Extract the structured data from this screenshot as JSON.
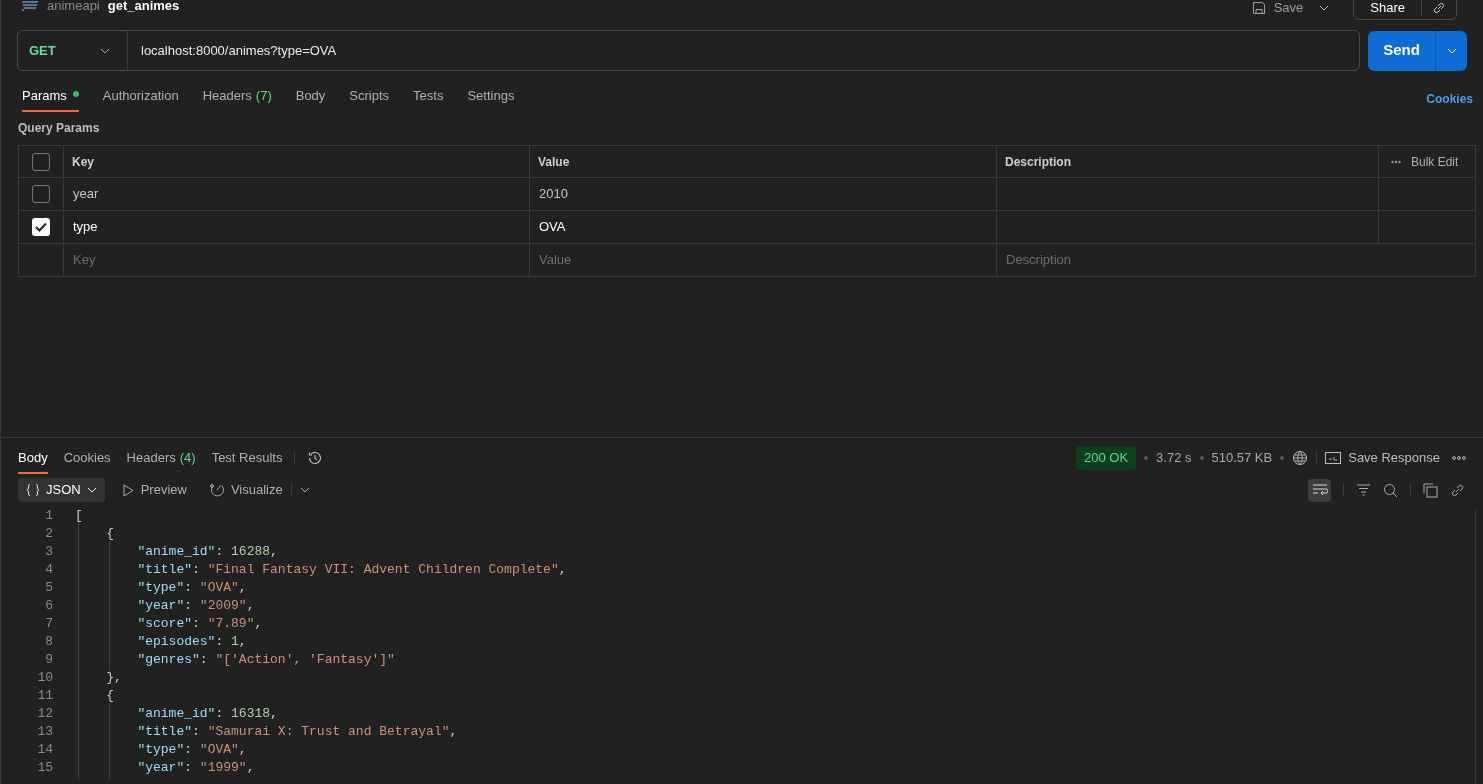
{
  "breadcrumb": {
    "collection": "animeapi",
    "request": "get_animes"
  },
  "header_actions": {
    "save": "Save",
    "share": "Share"
  },
  "request": {
    "method": "GET",
    "url": "localhost:8000/animes?type=OVA",
    "send": "Send"
  },
  "request_tabs": [
    {
      "label": "Params",
      "dot": true,
      "selected": true
    },
    {
      "label": "Authorization",
      "dot": false,
      "selected": false
    },
    {
      "label": "Headers",
      "count": "(7)",
      "dot": false,
      "selected": false
    },
    {
      "label": "Body",
      "dot": false,
      "selected": false
    },
    {
      "label": "Scripts",
      "dot": false,
      "selected": false
    },
    {
      "label": "Tests",
      "dot": false,
      "selected": false
    },
    {
      "label": "Settings",
      "dot": false,
      "selected": false
    }
  ],
  "cookies_link": "Cookies",
  "query_params": {
    "title": "Query Params",
    "columns": [
      "Key",
      "Value",
      "Description"
    ],
    "bulk_edit": "Bulk Edit",
    "header_checked": false,
    "rows": [
      {
        "key": "year",
        "value": "2010",
        "checked": false
      },
      {
        "key": "type",
        "value": "OVA",
        "checked": true
      }
    ],
    "new_row": [
      {
        "placeholder": "Key"
      },
      {
        "placeholder": "Value"
      },
      {
        "placeholder": "Description"
      }
    ]
  },
  "response_tabs": [
    {
      "label": "Body",
      "selected": true
    },
    {
      "label": "Cookies",
      "selected": false
    },
    {
      "label": "Headers",
      "count": "(4)",
      "selected": false
    },
    {
      "label": "Test Results",
      "selected": false
    }
  ],
  "response_meta": {
    "status": "200 OK",
    "time": "3.72 s",
    "size": "510.57 KB",
    "save_response": "Save Response"
  },
  "view": {
    "format": "JSON",
    "preview": "Preview",
    "visualize": "Visualize",
    "wrap_on": true
  },
  "code_lines": [
    {
      "number": "1",
      "tokens": [
        {
          "kind": "punct",
          "text": "["
        }
      ]
    },
    {
      "number": "2",
      "tokens": [
        {
          "kind": "punct",
          "text": "    {"
        }
      ]
    },
    {
      "number": "3",
      "tokens": [
        {
          "kind": "key",
          "text": "        \"anime_id\""
        },
        {
          "kind": "punct",
          "text": ": "
        },
        {
          "kind": "number",
          "text": "16288"
        },
        {
          "kind": "punct",
          "text": ","
        }
      ]
    },
    {
      "number": "4",
      "tokens": [
        {
          "kind": "key",
          "text": "        \"title\""
        },
        {
          "kind": "punct",
          "text": ": "
        },
        {
          "kind": "string",
          "text": "\"Final Fantasy VII: Advent Children Complete\""
        },
        {
          "kind": "punct",
          "text": ","
        }
      ]
    },
    {
      "number": "5",
      "tokens": [
        {
          "kind": "key",
          "text": "        \"type\""
        },
        {
          "kind": "punct",
          "text": ": "
        },
        {
          "kind": "string",
          "text": "\"OVA\""
        },
        {
          "kind": "punct",
          "text": ","
        }
      ]
    },
    {
      "number": "6",
      "tokens": [
        {
          "kind": "key",
          "text": "        \"year\""
        },
        {
          "kind": "punct",
          "text": ": "
        },
        {
          "kind": "string",
          "text": "\"2009\""
        },
        {
          "kind": "punct",
          "text": ","
        }
      ]
    },
    {
      "number": "7",
      "tokens": [
        {
          "kind": "key",
          "text": "        \"score\""
        },
        {
          "kind": "punct",
          "text": ": "
        },
        {
          "kind": "string",
          "text": "\"7.89\""
        },
        {
          "kind": "punct",
          "text": ","
        }
      ]
    },
    {
      "number": "8",
      "tokens": [
        {
          "kind": "key",
          "text": "        \"episodes\""
        },
        {
          "kind": "punct",
          "text": ": "
        },
        {
          "kind": "number",
          "text": "1"
        },
        {
          "kind": "punct",
          "text": ","
        }
      ]
    },
    {
      "number": "9",
      "tokens": [
        {
          "kind": "key",
          "text": "        \"genres\""
        },
        {
          "kind": "punct",
          "text": ": "
        },
        {
          "kind": "string",
          "text": "\"['Action', 'Fantasy']\""
        }
      ]
    },
    {
      "number": "10",
      "tokens": [
        {
          "kind": "punct",
          "text": "    },"
        }
      ]
    },
    {
      "number": "11",
      "tokens": [
        {
          "kind": "punct",
          "text": "    {"
        }
      ]
    },
    {
      "number": "12",
      "tokens": [
        {
          "kind": "key",
          "text": "        \"anime_id\""
        },
        {
          "kind": "punct",
          "text": ": "
        },
        {
          "kind": "number",
          "text": "16318"
        },
        {
          "kind": "punct",
          "text": ","
        }
      ]
    },
    {
      "number": "13",
      "tokens": [
        {
          "kind": "key",
          "text": "        \"title\""
        },
        {
          "kind": "punct",
          "text": ": "
        },
        {
          "kind": "string",
          "text": "\"Samurai X: Trust and Betrayal\""
        },
        {
          "kind": "punct",
          "text": ","
        }
      ]
    },
    {
      "number": "14",
      "tokens": [
        {
          "kind": "key",
          "text": "        \"type\""
        },
        {
          "kind": "punct",
          "text": ": "
        },
        {
          "kind": "string",
          "text": "\"OVA\""
        },
        {
          "kind": "punct",
          "text": ","
        }
      ]
    },
    {
      "number": "15",
      "tokens": [
        {
          "kind": "key",
          "text": "        \"year\""
        },
        {
          "kind": "punct",
          "text": ": "
        },
        {
          "kind": "string",
          "text": "\"1999\""
        },
        {
          "kind": "punct",
          "text": ","
        }
      ]
    }
  ]
}
